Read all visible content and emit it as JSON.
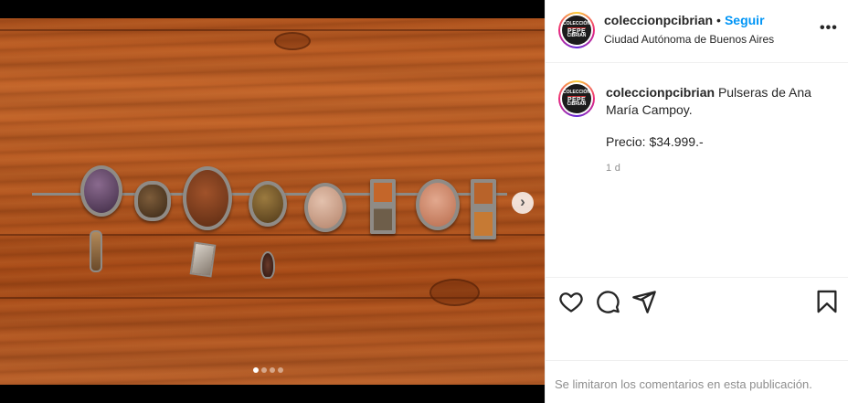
{
  "post": {
    "username": "coleccionpcibrian",
    "follow_label": "Seguir",
    "separator": "•",
    "location": "Ciudad Autónoma de Buenos Aires",
    "more_label": "•••",
    "caption_text": "Pulseras de Ana María Campoy.",
    "price": "Precio: $34.999.-",
    "time_ago": "1 d",
    "comments_disabled": "Se limitaron los comentarios en esta publicación."
  },
  "avatar": {
    "line1": "COLECCIÓN",
    "line2": "PEPE",
    "line3": "CIBRIAN"
  },
  "carousel": {
    "count": 4,
    "active_index": 0,
    "next_icon": "chevron-right-icon"
  },
  "icons": [
    "heart-icon",
    "comment-icon",
    "share-icon",
    "bookmark-icon"
  ],
  "colors": {
    "accent": "#0095f6",
    "text": "#262626",
    "muted": "#8e8e8e",
    "border": "#efefef"
  }
}
